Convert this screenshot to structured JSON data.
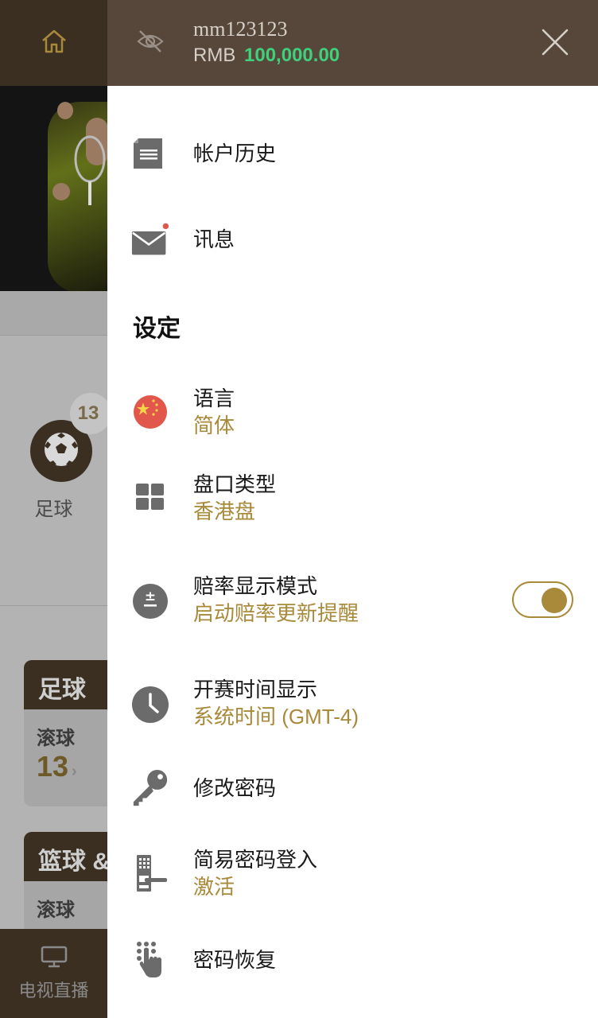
{
  "account": {
    "username": "mm123123",
    "currency": "RMB",
    "balance": "100,000.00"
  },
  "menu": {
    "account_history": {
      "label": "帐户历史"
    },
    "messages": {
      "label": "讯息",
      "has_unread": true
    },
    "settings_title": "设定",
    "language": {
      "label": "语言",
      "value": "简体"
    },
    "odds_type": {
      "label": "盘口类型",
      "value": "香港盘"
    },
    "odds_display": {
      "label": "赔率显示模式",
      "value": "启动赔率更新提醒",
      "toggle_on": true
    },
    "kickoff_time": {
      "label": "开赛时间显示",
      "value": "系统时间 (GMT-4)"
    },
    "change_password": {
      "label": "修改密码"
    },
    "easy_login": {
      "label": "简易密码登入",
      "value": "激活"
    },
    "password_recovery": {
      "label": "密码恢复"
    }
  },
  "background": {
    "sport_count": "13",
    "sport_name": "足球",
    "card1_title": "足球",
    "card1_live_label": "滚球",
    "card1_live_count": "13",
    "card2_title": "篮球 &",
    "card2_live_label": "滚球",
    "footer_label": "电视直播"
  },
  "colors": {
    "header_bg": "#56473a",
    "accent_gold": "#a9893a",
    "balance_green": "#3fd07c",
    "icon_gray": "#6b6b6b"
  }
}
